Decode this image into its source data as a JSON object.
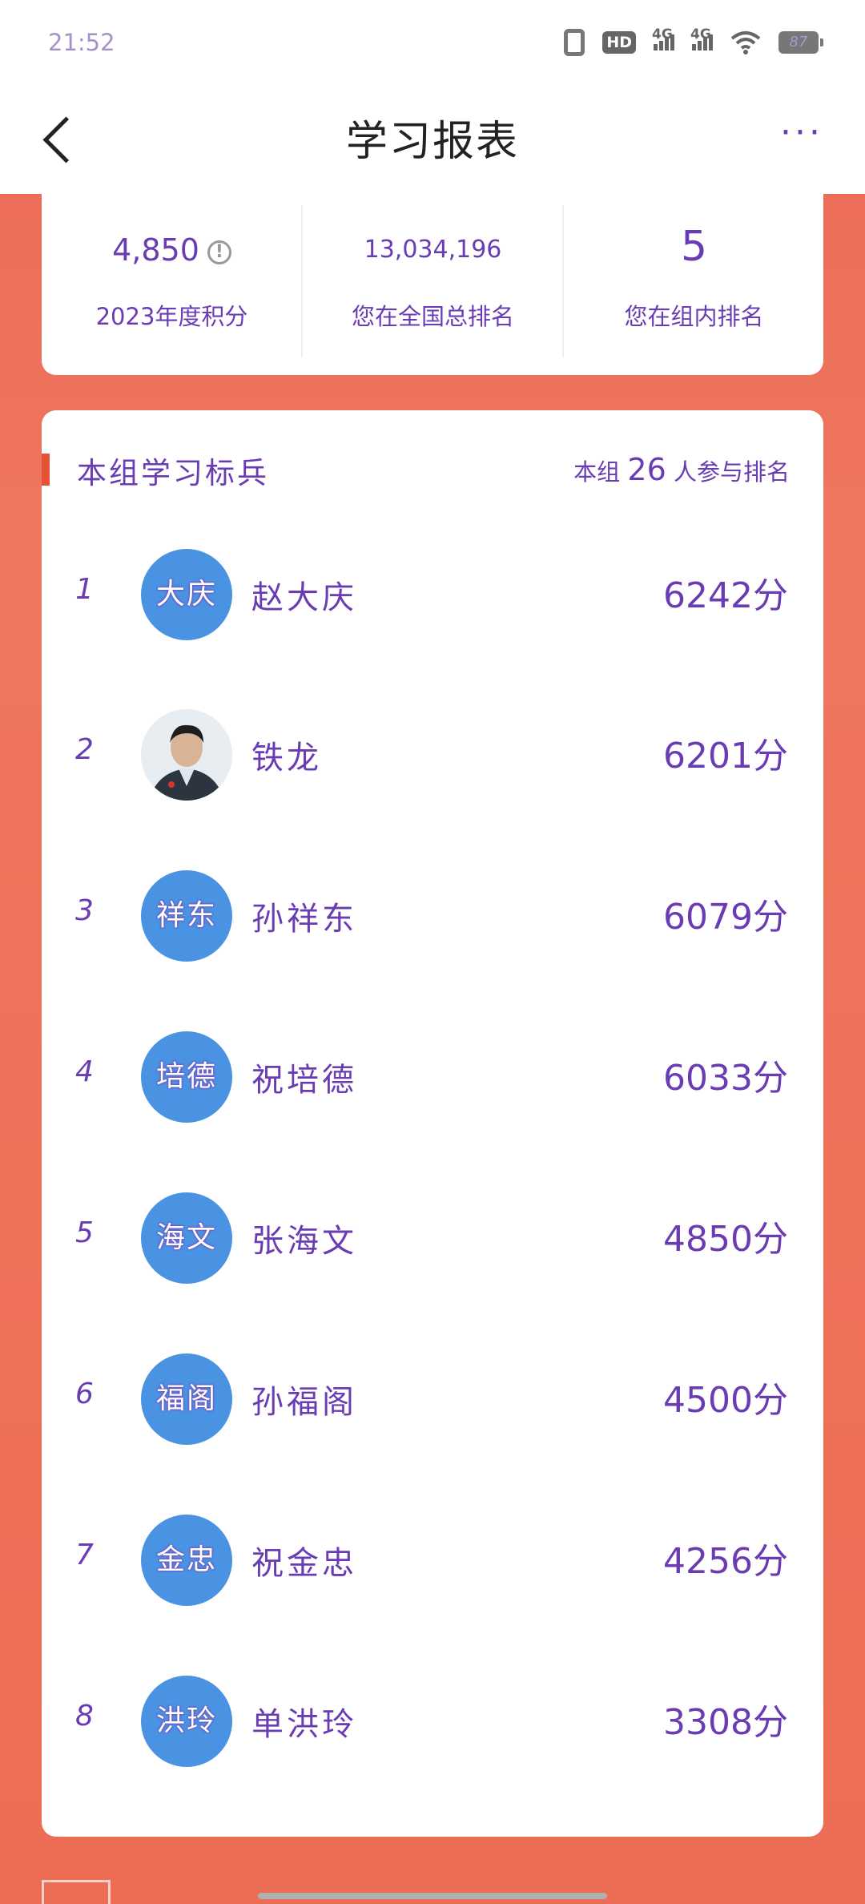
{
  "status_bar": {
    "time": "21:52",
    "hd_label": "HD",
    "net1": "4G",
    "net2": "4G",
    "battery": "87"
  },
  "header": {
    "title": "学习报表",
    "more_label": "···"
  },
  "stats": [
    {
      "value": "4,850",
      "label": "2023年度积分"
    },
    {
      "value": "13,034,196",
      "label": "您在全国总排名"
    },
    {
      "value": "5",
      "label": "您在组内排名"
    }
  ],
  "ranking": {
    "title": "本组学习标兵",
    "participants_prefix": "本组",
    "participants_count": "26",
    "participants_suffix": "人参与排名",
    "rows": [
      {
        "rank": "1",
        "avatar_text": "大庆",
        "name": "赵大庆",
        "score": "6242分"
      },
      {
        "rank": "2",
        "avatar_text": "",
        "name": "铁龙",
        "score": "6201分"
      },
      {
        "rank": "3",
        "avatar_text": "祥东",
        "name": "孙祥东",
        "score": "6079分"
      },
      {
        "rank": "4",
        "avatar_text": "培德",
        "name": "祝培德",
        "score": "6033分"
      },
      {
        "rank": "5",
        "avatar_text": "海文",
        "name": "张海文",
        "score": "4850分"
      },
      {
        "rank": "6",
        "avatar_text": "福阁",
        "name": "孙福阁",
        "score": "4500分"
      },
      {
        "rank": "7",
        "avatar_text": "金忠",
        "name": "祝金忠",
        "score": "4256分"
      },
      {
        "rank": "8",
        "avatar_text": "洪玲",
        "name": "单洪玲",
        "score": "3308分"
      }
    ]
  },
  "colors": {
    "accent_orange": "#ec6e58",
    "text_purple": "#6a3cb3",
    "avatar_blue": "#4a93e3"
  }
}
